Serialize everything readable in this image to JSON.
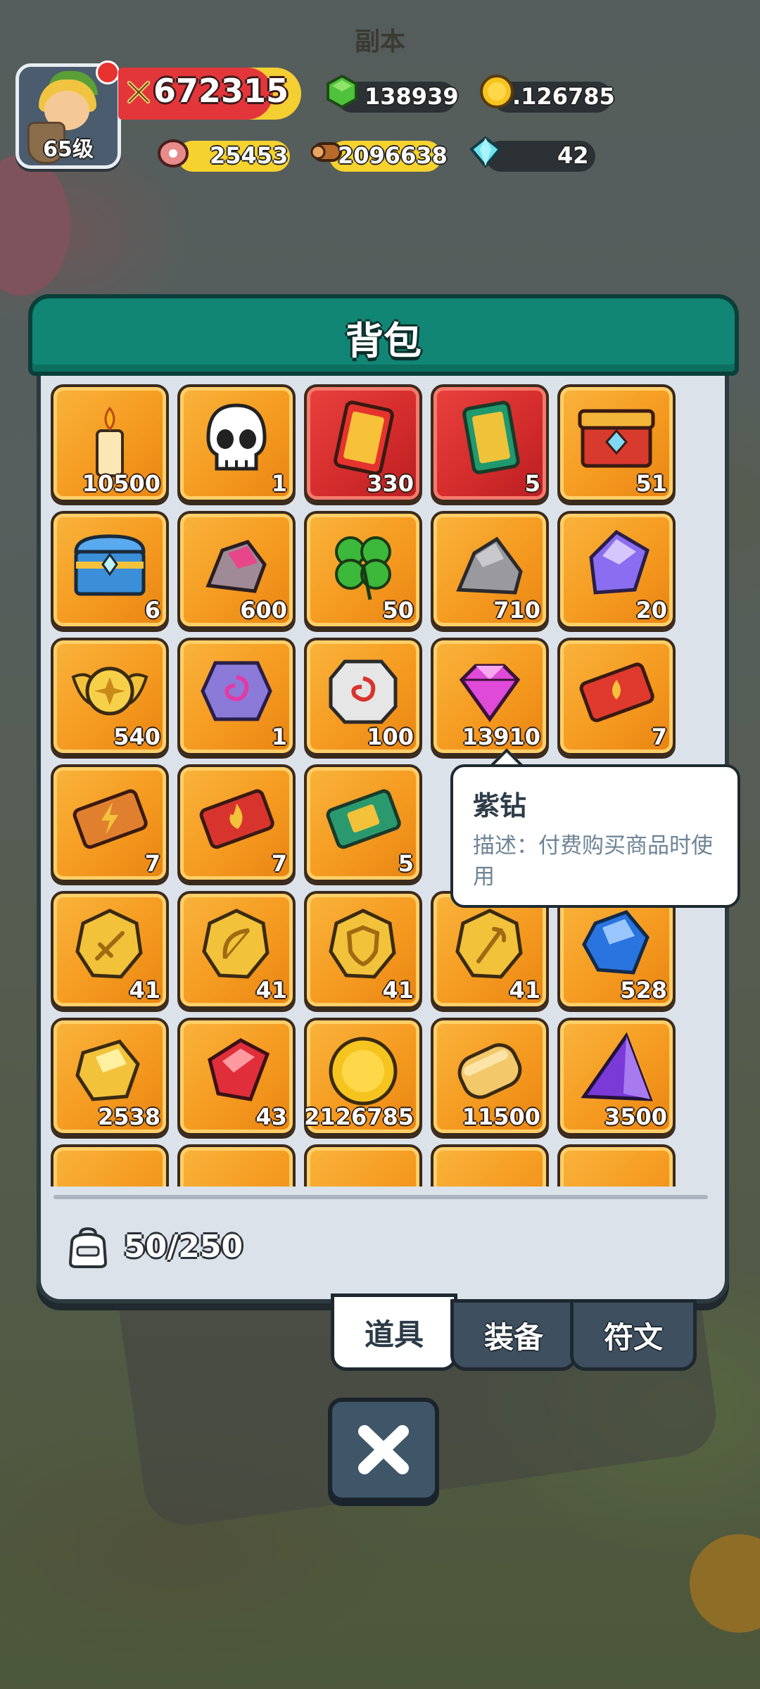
{
  "hud": {
    "scene_label": "副本",
    "player_level": "65级",
    "combat_power": "672315",
    "gems": "138939",
    "gold": ".126785",
    "meat": "25453",
    "wood": "2096638",
    "diamonds": "42"
  },
  "panel": {
    "title": "背包",
    "capacity": "50/250"
  },
  "items": [
    {
      "icon": "candle-icon",
      "count": "10500",
      "style": "orange"
    },
    {
      "icon": "skull-icon",
      "count": "1",
      "style": "orange"
    },
    {
      "icon": "red-card-icon",
      "count": "330",
      "style": "red"
    },
    {
      "icon": "green-card-icon",
      "count": "5",
      "style": "red"
    },
    {
      "icon": "red-chest-icon",
      "count": "51",
      "style": "orange"
    },
    {
      "icon": "blue-chest-icon",
      "count": "6",
      "style": "orange"
    },
    {
      "icon": "pink-ore-icon",
      "count": "600",
      "style": "orange"
    },
    {
      "icon": "clover-icon",
      "count": "50",
      "style": "orange"
    },
    {
      "icon": "stone-icon",
      "count": "710",
      "style": "orange"
    },
    {
      "icon": "purple-crystal-icon",
      "count": "20",
      "style": "orange"
    },
    {
      "icon": "winged-badge-icon",
      "count": "540",
      "style": "orange"
    },
    {
      "icon": "purple-rune-stone-icon",
      "count": "1",
      "style": "orange"
    },
    {
      "icon": "white-rune-stone-icon",
      "count": "100",
      "style": "orange"
    },
    {
      "icon": "purple-diamond-icon",
      "count": "13910",
      "style": "orange"
    },
    {
      "icon": "red-ticket-drop-icon",
      "count": "7",
      "style": "orange"
    },
    {
      "icon": "bolt-ticket-icon",
      "count": "7",
      "style": "orange"
    },
    {
      "icon": "fire-ticket-icon",
      "count": "7",
      "style": "orange"
    },
    {
      "icon": "green-ticket-icon",
      "count": "5",
      "style": "orange"
    },
    {
      "icon": "hidden",
      "count": "",
      "style": "orange"
    },
    {
      "icon": "hidden",
      "count": "",
      "style": "orange"
    },
    {
      "icon": "sword-coin-icon",
      "count": "41",
      "style": "orange"
    },
    {
      "icon": "bow-coin-icon",
      "count": "41",
      "style": "orange"
    },
    {
      "icon": "shield-coin-icon",
      "count": "41",
      "style": "orange"
    },
    {
      "icon": "staff-coin-icon",
      "count": "41",
      "style": "orange"
    },
    {
      "icon": "blue-gem-icon",
      "count": "528",
      "style": "orange"
    },
    {
      "icon": "gold-ore-icon",
      "count": "2538",
      "style": "orange"
    },
    {
      "icon": "red-crystal-icon",
      "count": "43",
      "style": "orange"
    },
    {
      "icon": "gold-coin-icon",
      "count": "2126785",
      "style": "orange"
    },
    {
      "icon": "bread-icon",
      "count": "11500",
      "style": "orange"
    },
    {
      "icon": "purple-pyramid-icon",
      "count": "3500",
      "style": "orange"
    },
    {
      "icon": "",
      "count": "",
      "style": "orange"
    },
    {
      "icon": "",
      "count": "",
      "style": "orange"
    },
    {
      "icon": "",
      "count": "",
      "style": "orange"
    },
    {
      "icon": "",
      "count": "",
      "style": "orange"
    },
    {
      "icon": "",
      "count": "",
      "style": "orange"
    }
  ],
  "tooltip": {
    "title": "紫钻",
    "description": "描述：付费购买商品时使用"
  },
  "tabs": [
    {
      "label": "道具",
      "active": true
    },
    {
      "label": "装备",
      "active": false
    },
    {
      "label": "符文",
      "active": false
    }
  ],
  "colors": {
    "panel_header": "#118675",
    "item_orange": "#f59a20",
    "item_red": "#d22b2b",
    "panel_bg": "#dbe2ea"
  }
}
